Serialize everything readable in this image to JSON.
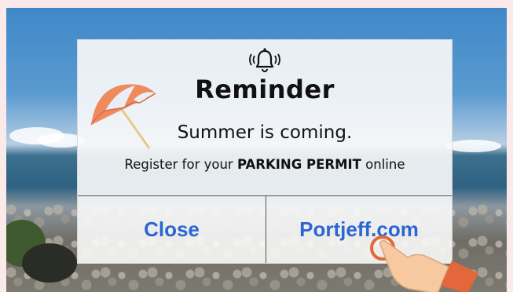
{
  "dialog": {
    "bell_icon": "bell-ringing-icon",
    "title": "Reminder",
    "subtitle": "Summer is coming.",
    "register_prefix": "Register for your ",
    "register_bold": "PARKING PERMIT",
    "register_suffix": " online"
  },
  "buttons": {
    "close_label": "Close",
    "link_label": "Portjeff.com"
  },
  "colors": {
    "button_text": "#2c66d3",
    "umbrella": "#f08a5d",
    "hand": "#f6c9a0",
    "sleeve": "#e4673b"
  },
  "decor": {
    "umbrella_icon": "beach-umbrella-icon",
    "hand_icon": "pointing-hand-icon"
  }
}
